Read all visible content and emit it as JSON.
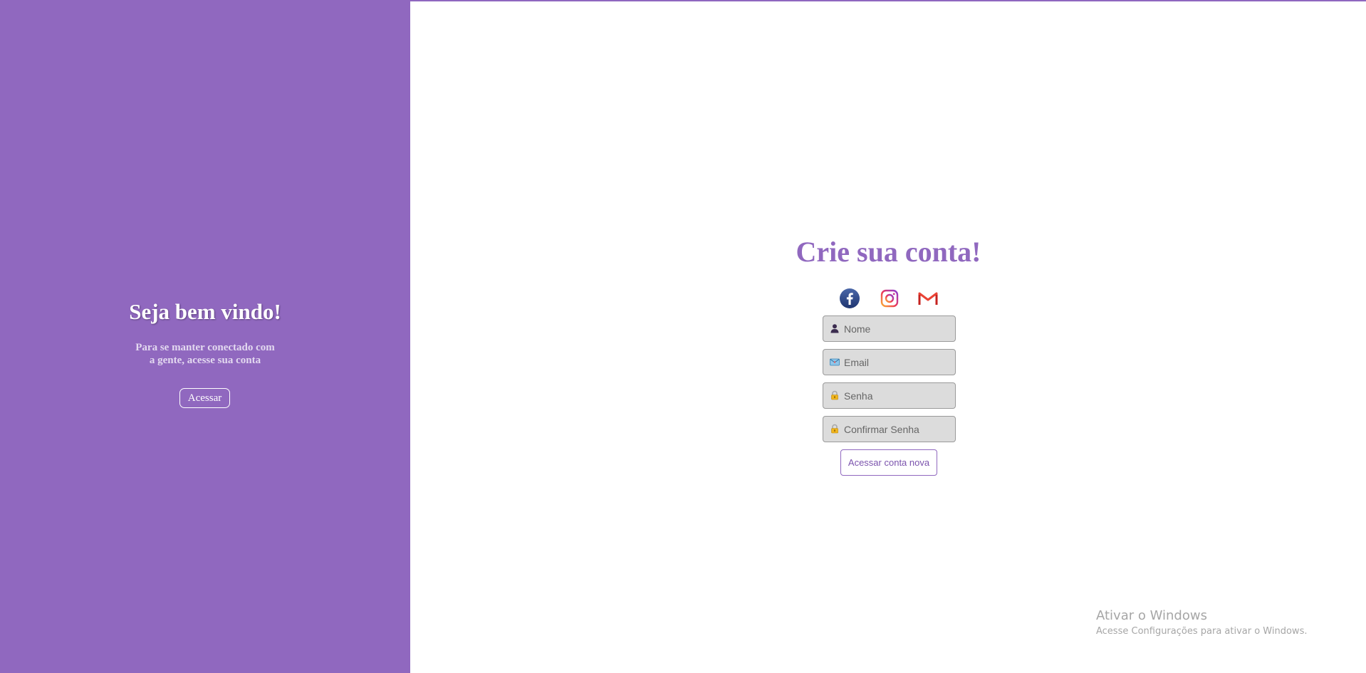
{
  "welcome_panel": {
    "title": "Seja bem vindo!",
    "text_line1": "Para se manter conectado com",
    "text_line2": "a gente, acesse sua conta",
    "button_label": "Acessar",
    "background_color": "#9068bf"
  },
  "signup": {
    "title": "Crie sua conta!",
    "social": [
      {
        "name": "facebook",
        "icon": "facebook-icon"
      },
      {
        "name": "instagram",
        "icon": "instagram-icon"
      },
      {
        "name": "gmail",
        "icon": "gmail-icon"
      }
    ],
    "fields": [
      {
        "icon": "user-icon",
        "placeholder": "Nome",
        "value": ""
      },
      {
        "icon": "email-icon",
        "placeholder": "Email",
        "value": ""
      },
      {
        "icon": "lock-icon",
        "placeholder": "Senha",
        "value": ""
      },
      {
        "icon": "lock-icon",
        "placeholder": "Confirmar Senha",
        "value": ""
      }
    ],
    "submit_label": "Acessar conta nova",
    "accent_color": "#9068bf"
  },
  "watermark": {
    "title": "Ativar o Windows",
    "subtitle": "Acesse Configurações para ativar o Windows."
  }
}
